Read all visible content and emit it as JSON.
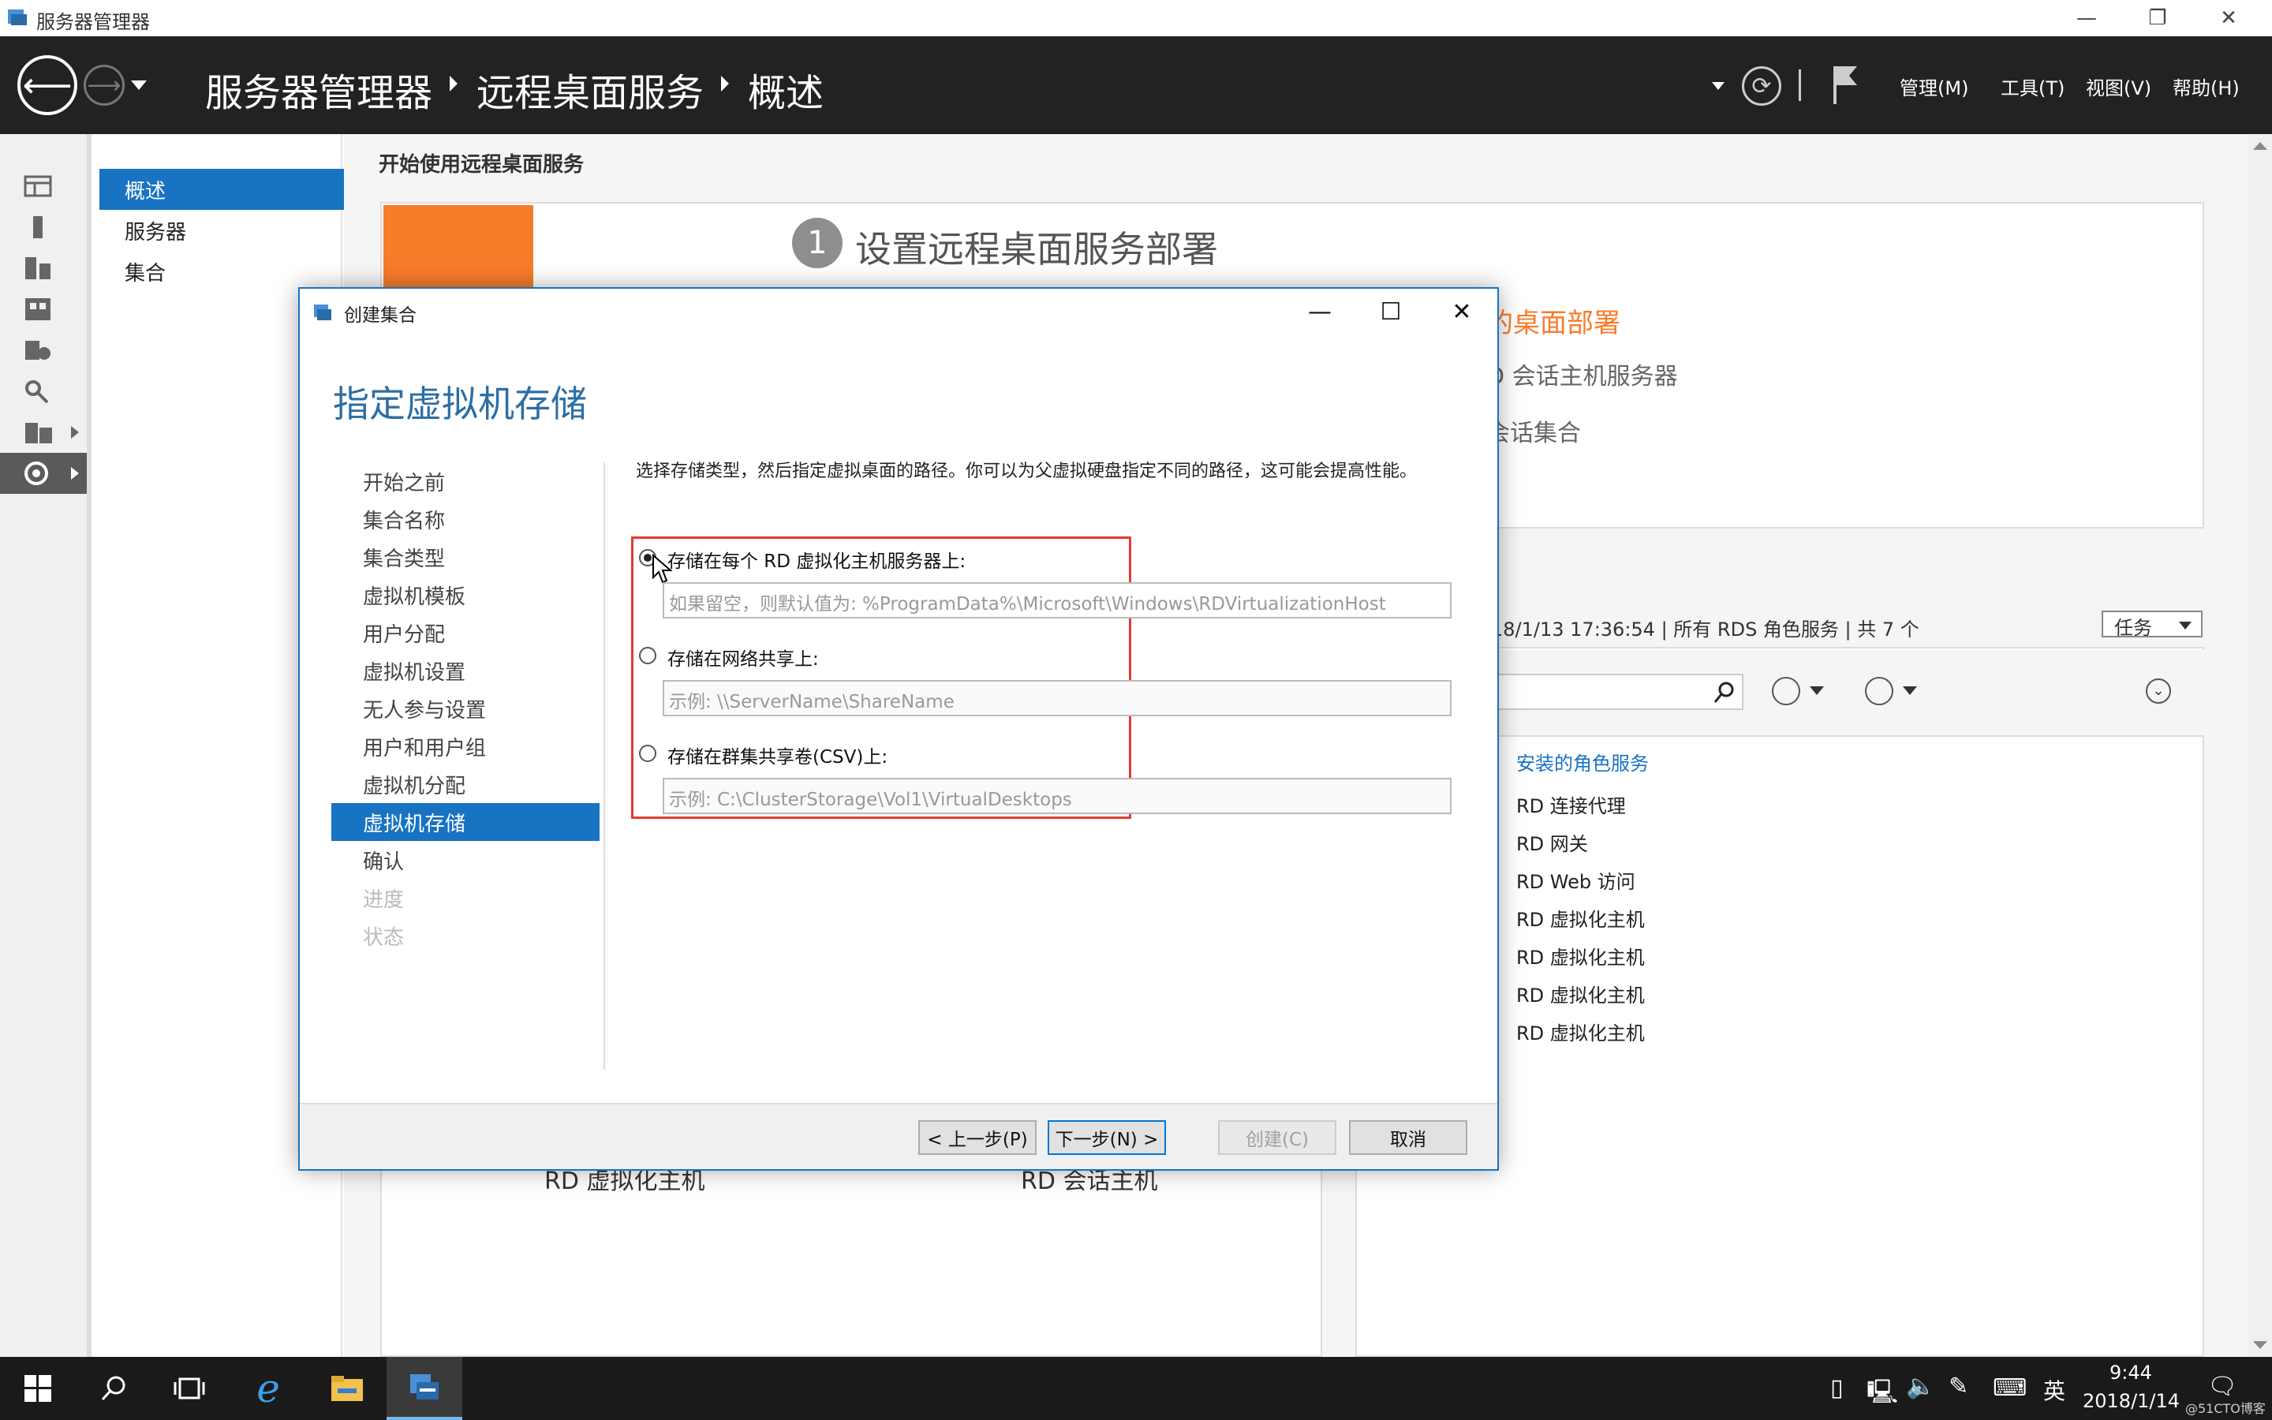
{
  "window": {
    "title": "服务器管理器",
    "controls": [
      "—",
      "❐",
      "✕"
    ]
  },
  "header": {
    "breadcrumb": [
      "服务器管理器",
      "远程桌面服务",
      "概述"
    ],
    "menus": [
      "管理(M)",
      "工具(T)",
      "视图(V)",
      "帮助(H)"
    ]
  },
  "nav": {
    "items": [
      "概述",
      "服务器",
      "集合"
    ]
  },
  "main": {
    "section_title": "开始使用远程桌面服务",
    "step_number": "1",
    "step_title": "设置远程桌面服务部署",
    "partial_link": "的桌面部署",
    "partial_text_1": "D 会话主机服务器",
    "partial_text_2": "会话集合",
    "servers_info": "18/1/13 17:36:54 | 所有 RDS 角色服务 | 共 7 个",
    "tasks_label": "任务",
    "roles_header": "安装的角色服务",
    "roles": [
      "RD 连接代理",
      "RD 网关",
      "RD Web 访问",
      "RD 虚拟化主机",
      "RD 虚拟化主机",
      "RD 虚拟化主机",
      "RD 虚拟化主机"
    ],
    "bottom_label_1": "RD 虚拟化主机",
    "bottom_label_2": "RD 会话主机"
  },
  "dialog": {
    "title": "创建集合",
    "heading": "指定虚拟机存储",
    "steps": [
      {
        "label": "开始之前",
        "state": "normal"
      },
      {
        "label": "集合名称",
        "state": "normal"
      },
      {
        "label": "集合类型",
        "state": "normal"
      },
      {
        "label": "虚拟机模板",
        "state": "normal"
      },
      {
        "label": "用户分配",
        "state": "normal"
      },
      {
        "label": "虚拟机设置",
        "state": "normal"
      },
      {
        "label": "无人参与设置",
        "state": "normal"
      },
      {
        "label": "用户和用户组",
        "state": "normal"
      },
      {
        "label": "虚拟机分配",
        "state": "normal"
      },
      {
        "label": "虚拟机存储",
        "state": "selected"
      },
      {
        "label": "确认",
        "state": "normal"
      },
      {
        "label": "进度",
        "state": "disabled"
      },
      {
        "label": "状态",
        "state": "disabled"
      }
    ],
    "description": "选择存储类型，然后指定虚拟桌面的路径。你可以为父虚拟硬盘指定不同的路径，这可能会提高性能。",
    "options": [
      {
        "label": "存储在每个 RD 虚拟化主机服务器上:",
        "placeholder": "如果留空，则默认值为: %ProgramData%\\Microsoft\\Windows\\RDVirtualizationHost",
        "selected": true
      },
      {
        "label": "存储在网络共享上:",
        "placeholder": "示例: \\\\ServerName\\ShareName",
        "selected": false
      },
      {
        "label": "存储在群集共享卷(CSV)上:",
        "placeholder": "示例: C:\\ClusterStorage\\Vol1\\VirtualDesktops",
        "selected": false
      }
    ],
    "buttons": {
      "prev": "< 上一步(P)",
      "next": "下一步(N) >",
      "create": "创建(C)",
      "cancel": "取消"
    },
    "highlight_color": "#e53935"
  },
  "taskbar": {
    "ime": "英",
    "time": "9:44",
    "date": "2018/1/14",
    "watermark": "@51CTO博客"
  },
  "colors": {
    "accent": "#1873c2",
    "header_bg": "#222222",
    "orange": "#f77c2a"
  }
}
